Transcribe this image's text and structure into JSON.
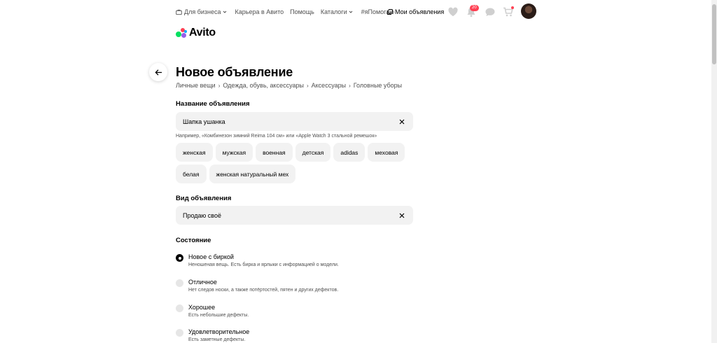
{
  "nav": {
    "business": "Для бизнеса",
    "career": "Карьера в Авито",
    "help": "Помощь",
    "catalogs": "Каталоги",
    "ihelp": "#яПомогаю",
    "my_ads": "Мои объявления",
    "notifications_count": "20"
  },
  "logo": {
    "text": "Avito",
    "colors": [
      "#04e061",
      "#ff4053",
      "#965eeb",
      "#0af"
    ]
  },
  "page": {
    "title": "Новое объявление",
    "breadcrumbs": [
      "Личные вещи",
      "Одежда, обувь, аксессуары",
      "Аксессуары",
      "Головные уборы"
    ]
  },
  "name_section": {
    "label": "Название объявления",
    "value": "Шапка ушанка",
    "hint": "Например, «Комбинезон зимний Reima 104 см» или «Apple Watch 3 стальной ремешок»",
    "chips": [
      "женская",
      "мужская",
      "военная",
      "детская",
      "adidas",
      "меховая",
      "белая",
      "женская натуральный мех"
    ]
  },
  "type_section": {
    "label": "Вид объявления",
    "value": "Продаю своё"
  },
  "condition": {
    "label": "Состояние",
    "selected": 0,
    "options": [
      {
        "title": "Новое с биркой",
        "desc": "Неношеная вещь. Есть бирка и ярлыки с информацией о модели."
      },
      {
        "title": "Отличное",
        "desc": "Нет следов носки, а также потёртостей, пятен и других дефектов."
      },
      {
        "title": "Хорошее",
        "desc": "Есть небольшие дефекты."
      },
      {
        "title": "Удовлетворительное",
        "desc": "Есть заметные дефекты."
      }
    ]
  }
}
